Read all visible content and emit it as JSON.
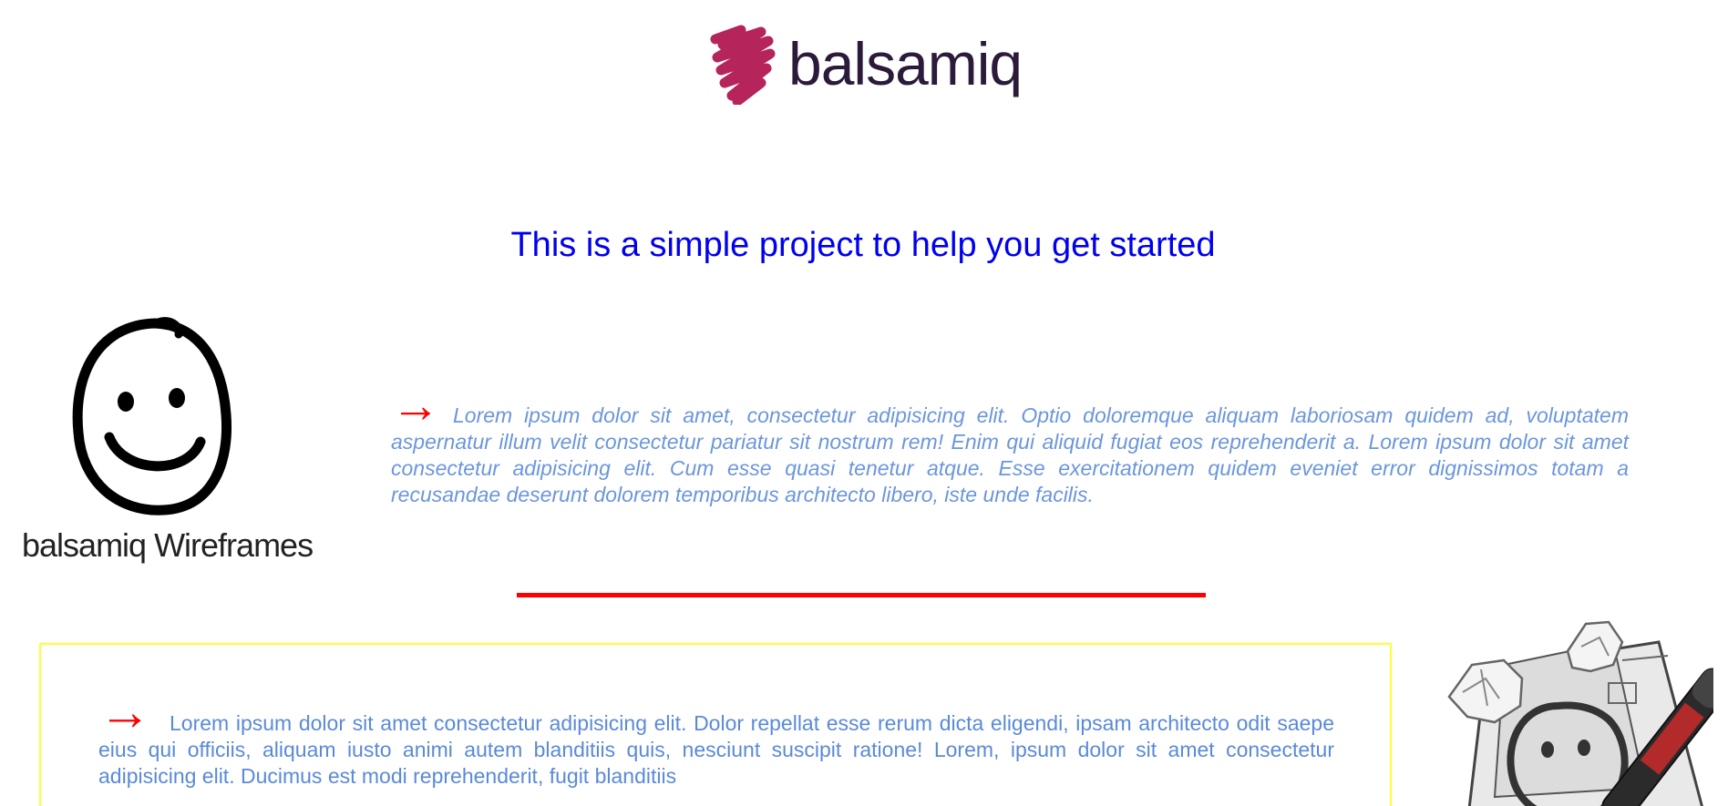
{
  "brand": {
    "name": "balsamiq",
    "color": "#2b1a3a",
    "mark_color": "#b5245b"
  },
  "headline": "This is a simple project to help you get started",
  "wireframes_logo": {
    "caption": "balsamiq Wireframes",
    "registered": "®"
  },
  "section1": {
    "arrow": "→",
    "text": "Lorem ipsum dolor sit amet, consectetur adipisicing elit. Optio doloremque aliquam laboriosam quidem ad, voluptatem aspernatur illum velit consectetur pariatur sit nostrum rem! Enim qui aliquid fugiat eos reprehenderit a. Lorem ipsum dolor sit amet consectetur adipisicing elit. Cum esse quasi tenetur atque. Esse exercitationem quidem eveniet error dignissimos totam a recusandae deserunt dolorem temporibus architecto libero, iste unde facilis."
  },
  "section2": {
    "arrow": "→",
    "text": "Lorem ipsum dolor sit amet consectetur adipisicing elit. Dolor repellat esse rerum dicta eligendi, ipsam architecto odit saepe eius qui officiis, aliquam iusto animi autem blanditiis quis, nesciunt suscipit ratione! Lorem, ipsum dolor sit amet consectetur adipisicing elit. Ducimus est modi reprehenderit, fugit blanditiis"
  },
  "colors": {
    "headline": "#0000ee",
    "body_text": "#6b96dd",
    "arrow": "#ff0000",
    "divider": "#ff0000",
    "box_border": "#ffff33"
  },
  "icons": {
    "brand_mark": "balsamiq-scribble-icon",
    "smiley": "smiley-face-icon",
    "editor": "balsamiq-editor-app-icon"
  }
}
